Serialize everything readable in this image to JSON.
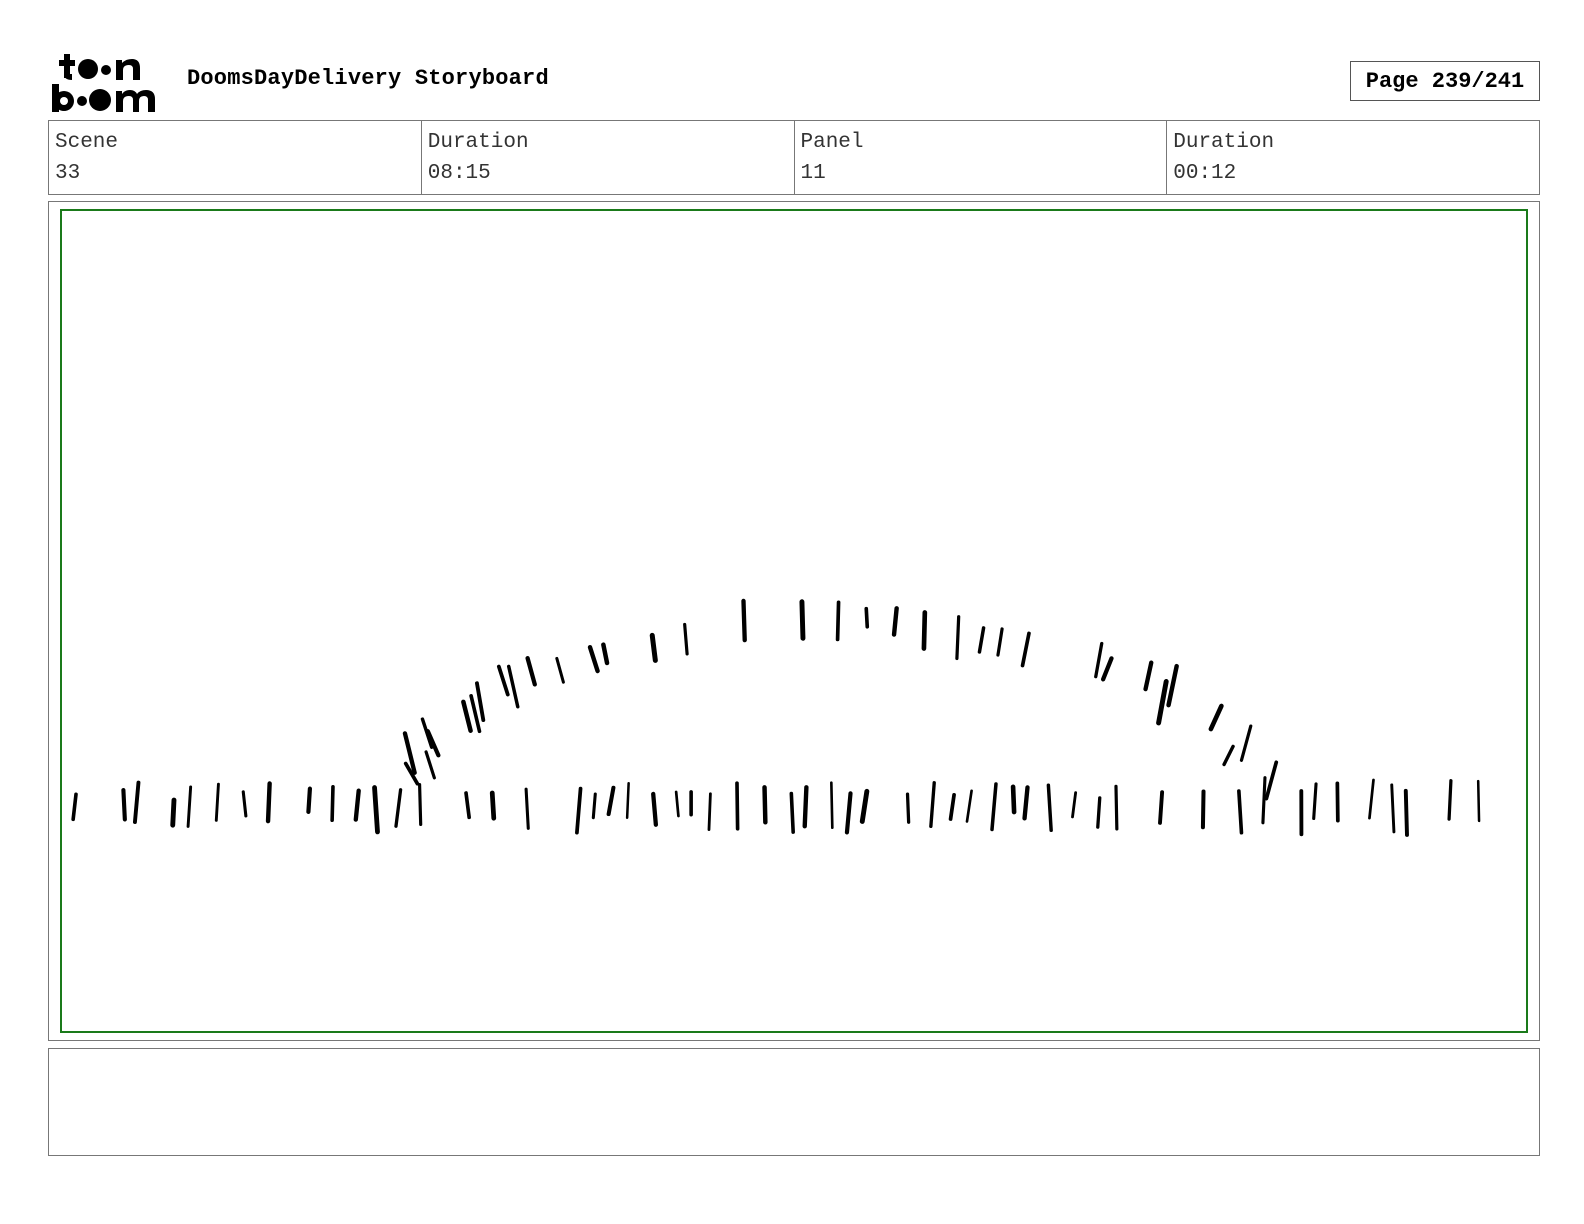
{
  "logo": {
    "line1": "toon",
    "line2": "boom"
  },
  "header": {
    "title": "DoomsDayDelivery Storyboard",
    "page": "Page 239/241"
  },
  "info": [
    {
      "label": "Scene",
      "value": "33"
    },
    {
      "label": "Duration",
      "value": "08:15"
    },
    {
      "label": "Panel",
      "value": "11"
    },
    {
      "label": "Duration",
      "value": "00:12"
    }
  ],
  "panel": {
    "border_color": "#1a7a1a",
    "sketch_color": "#000000"
  },
  "notes": {
    "text": ""
  }
}
